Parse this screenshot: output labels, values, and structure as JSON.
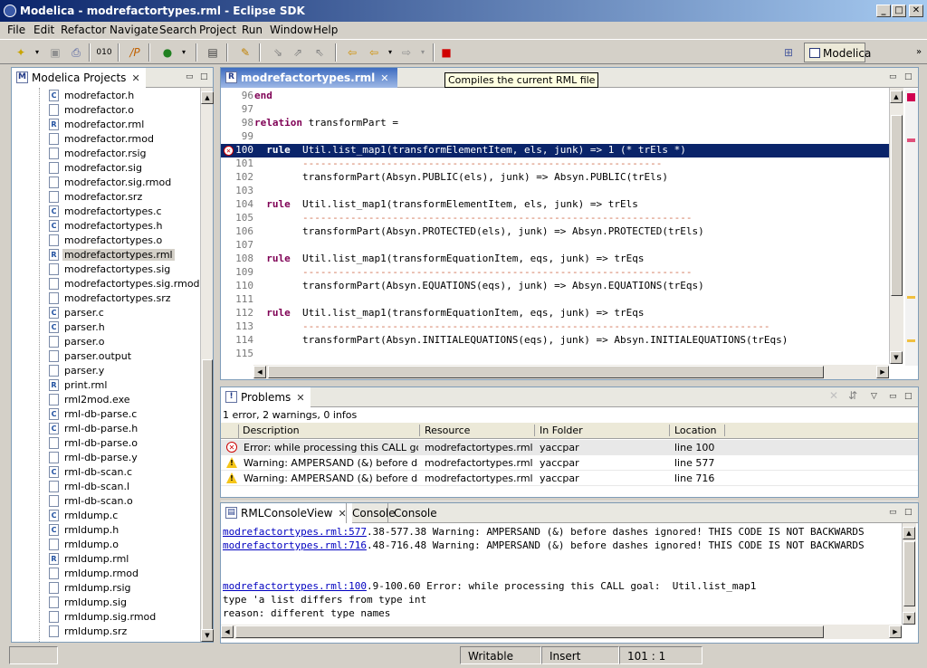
{
  "window": {
    "title": "Modelica - modrefactortypes.rml - Eclipse SDK",
    "buttons": [
      "_",
      "□",
      "✕"
    ]
  },
  "menu": [
    "File",
    "Edit",
    "Refactor",
    "Navigate",
    "Search",
    "Project",
    "Run",
    "Window",
    "Help"
  ],
  "perspective": {
    "label": "Modelica"
  },
  "tree": {
    "tab_label": "Modelica Projects",
    "items": [
      {
        "name": "modrefactor.h",
        "type": "c"
      },
      {
        "name": "modrefactor.o",
        "type": "f"
      },
      {
        "name": "modrefactor.rml",
        "type": "r"
      },
      {
        "name": "modrefactor.rmod",
        "type": "f"
      },
      {
        "name": "modrefactor.rsig",
        "type": "f"
      },
      {
        "name": "modrefactor.sig",
        "type": "f"
      },
      {
        "name": "modrefactor.sig.rmod",
        "type": "f"
      },
      {
        "name": "modrefactor.srz",
        "type": "f"
      },
      {
        "name": "modrefactortypes.c",
        "type": "c"
      },
      {
        "name": "modrefactortypes.h",
        "type": "c"
      },
      {
        "name": "modrefactortypes.o",
        "type": "f"
      },
      {
        "name": "modrefactortypes.rml",
        "type": "r",
        "selected": true
      },
      {
        "name": "modrefactortypes.sig",
        "type": "f"
      },
      {
        "name": "modrefactortypes.sig.rmod",
        "type": "f"
      },
      {
        "name": "modrefactortypes.srz",
        "type": "f"
      },
      {
        "name": "parser.c",
        "type": "c"
      },
      {
        "name": "parser.h",
        "type": "c"
      },
      {
        "name": "parser.o",
        "type": "f"
      },
      {
        "name": "parser.output",
        "type": "f"
      },
      {
        "name": "parser.y",
        "type": "f"
      },
      {
        "name": "print.rml",
        "type": "r"
      },
      {
        "name": "rml2mod.exe",
        "type": "f"
      },
      {
        "name": "rml-db-parse.c",
        "type": "c"
      },
      {
        "name": "rml-db-parse.h",
        "type": "c"
      },
      {
        "name": "rml-db-parse.o",
        "type": "f"
      },
      {
        "name": "rml-db-parse.y",
        "type": "f"
      },
      {
        "name": "rml-db-scan.c",
        "type": "c"
      },
      {
        "name": "rml-db-scan.l",
        "type": "f"
      },
      {
        "name": "rml-db-scan.o",
        "type": "f"
      },
      {
        "name": "rmldump.c",
        "type": "c"
      },
      {
        "name": "rmldump.h",
        "type": "c"
      },
      {
        "name": "rmldump.o",
        "type": "f"
      },
      {
        "name": "rmldump.rml",
        "type": "r"
      },
      {
        "name": "rmldump.rmod",
        "type": "f"
      },
      {
        "name": "rmldump.rsig",
        "type": "f"
      },
      {
        "name": "rmldump.sig",
        "type": "f"
      },
      {
        "name": "rmldump.sig.rmod",
        "type": "f"
      },
      {
        "name": "rmldump.srz",
        "type": "f"
      }
    ]
  },
  "editor": {
    "tab_label": "modrefactortypes.rml",
    "tooltip": "Compiles the current RML file",
    "lines": [
      {
        "n": "96",
        "code": "end"
      },
      {
        "n": "97",
        "code": ""
      },
      {
        "n": "98",
        "code": "relation transformPart ="
      },
      {
        "n": "99",
        "code": ""
      },
      {
        "n": "100",
        "code": "  rule  Util.list_map1(transformElementItem, els, junk) => 1 (* trEls *)",
        "error": true
      },
      {
        "n": "101",
        "code": "        ------------------------------------------------------------",
        "dash": true
      },
      {
        "n": "102",
        "code": "        transformPart(Absyn.PUBLIC(els), junk) => Absyn.PUBLIC(trEls)"
      },
      {
        "n": "103",
        "code": ""
      },
      {
        "n": "104",
        "code": "  rule  Util.list_map1(transformElementItem, els, junk) => trEls"
      },
      {
        "n": "105",
        "code": "        -----------------------------------------------------------------",
        "dash": true
      },
      {
        "n": "106",
        "code": "        transformPart(Absyn.PROTECTED(els), junk) => Absyn.PROTECTED(trEls)"
      },
      {
        "n": "107",
        "code": ""
      },
      {
        "n": "108",
        "code": "  rule  Util.list_map1(transformEquationItem, eqs, junk) => trEqs"
      },
      {
        "n": "109",
        "code": "        -----------------------------------------------------------------",
        "dash": true
      },
      {
        "n": "110",
        "code": "        transformPart(Absyn.EQUATIONS(eqs), junk) => Absyn.EQUATIONS(trEqs)"
      },
      {
        "n": "111",
        "code": ""
      },
      {
        "n": "112",
        "code": "  rule  Util.list_map1(transformEquationItem, eqs, junk) => trEqs"
      },
      {
        "n": "113",
        "code": "        ------------------------------------------------------------------------------",
        "dash": true
      },
      {
        "n": "114",
        "code": "        transformPart(Absyn.INITIALEQUATIONS(eqs), junk) => Absyn.INITIALEQUATIONS(trEqs)"
      },
      {
        "n": "115",
        "code": ""
      }
    ]
  },
  "problems": {
    "tab_label": "Problems",
    "summary": "1 error, 2 warnings, 0 infos",
    "columns": [
      "Description",
      "Resource",
      "In Folder",
      "Location"
    ],
    "rows": [
      {
        "kind": "error",
        "desc": "Error: while processing this CALL go...",
        "resource": "modrefactortypes.rml",
        "folder": "yaccpar",
        "location": "line 100"
      },
      {
        "kind": "warning",
        "desc": "Warning: AMPERSAND (&) before da...",
        "resource": "modrefactortypes.rml",
        "folder": "yaccpar",
        "location": "line 577"
      },
      {
        "kind": "warning",
        "desc": "Warning: AMPERSAND (&) before da...",
        "resource": "modrefactortypes.rml",
        "folder": "yaccpar",
        "location": "line 716"
      }
    ]
  },
  "console": {
    "tabs": [
      "RMLConsoleView",
      "Console",
      "Console"
    ],
    "lines": [
      {
        "link": "modrefactortypes.rml:577",
        "text": ".38-577.38 Warning: AMPERSAND (&) before dashes ignored! THIS CODE IS NOT BACKWARDS"
      },
      {
        "link": "modrefactortypes.rml:716",
        "text": ".48-716.48 Warning: AMPERSAND (&) before dashes ignored! THIS CODE IS NOT BACKWARDS"
      },
      {
        "link": "",
        "text": ""
      },
      {
        "link": "",
        "text": ""
      },
      {
        "link": "modrefactortypes.rml:100",
        "text": ".9-100.60 Error: while processing this CALL goal:  Util.list_map1"
      },
      {
        "link": "",
        "text": "type 'a list differs from type int"
      },
      {
        "link": "",
        "text": "reason: different type names"
      }
    ]
  },
  "status": {
    "writable": "Writable",
    "insert": "Insert",
    "position": "101 : 1"
  }
}
